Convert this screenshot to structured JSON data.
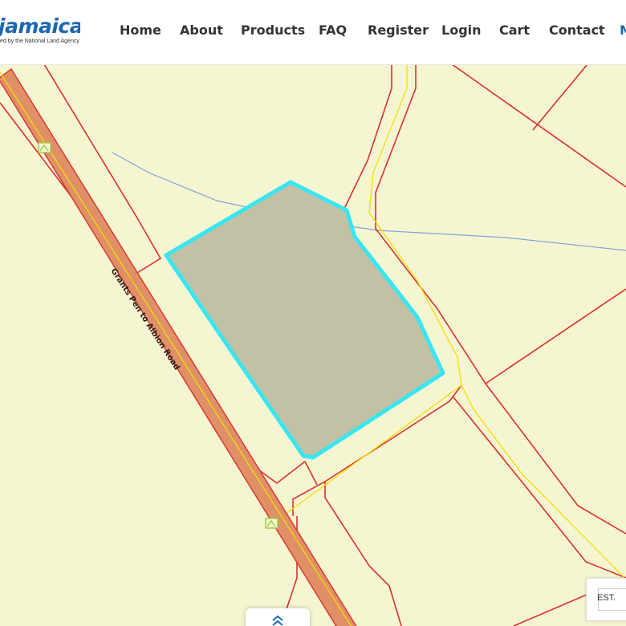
{
  "header": {
    "logo_text": "jamaica",
    "logo_subtext": "ed by the National Land Agency",
    "nav": [
      {
        "label": "Home"
      },
      {
        "label": "About"
      },
      {
        "label": "Products"
      },
      {
        "label": "FAQ"
      },
      {
        "label": "Register"
      },
      {
        "label": "Login"
      },
      {
        "label": "Cart"
      },
      {
        "label": "Contact"
      },
      {
        "label": "M"
      }
    ]
  },
  "map": {
    "road_label": "Grants Pen to Albion Road",
    "colors": {
      "background": "#f6f5d2",
      "parcel_line": "#d9312c",
      "highlight_outline": "#38e6f2",
      "highlight_fill": "#c2c0a5",
      "road_fill": "#e09066",
      "road_centerline": "#f2e000",
      "stream": "#7aa6d6",
      "marker": "#9ccf45"
    },
    "marker_icons": [
      "map-marker-icon",
      "map-marker-icon"
    ]
  },
  "estimate_box": {
    "label": "EST."
  },
  "scroll_button": {
    "icon": "double-chevron-up-icon"
  }
}
